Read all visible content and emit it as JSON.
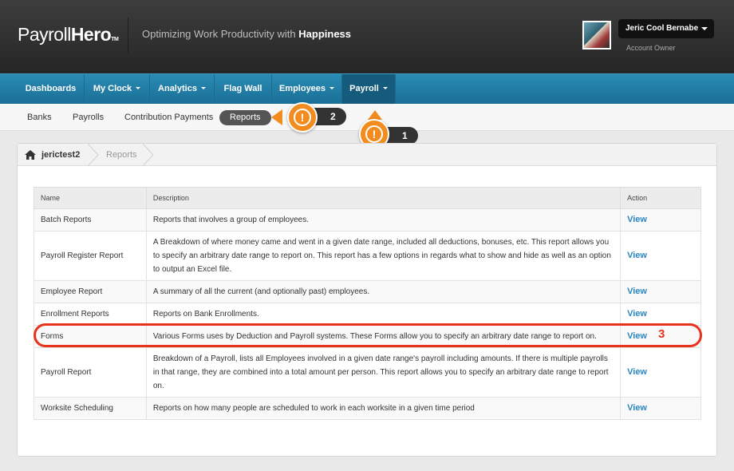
{
  "header": {
    "logo_light": "Payroll",
    "logo_bold": "Hero",
    "logo_tm": "TM",
    "tagline_prefix": "Optimizing Work Productivity with ",
    "tagline_bold": "Happiness",
    "user_name": "Jeric Cool Bernabe",
    "user_role": "Account Owner"
  },
  "nav": {
    "items": [
      {
        "label": "Dashboards"
      },
      {
        "label": "My Clock"
      },
      {
        "label": "Analytics"
      },
      {
        "label": "Flag Wall"
      },
      {
        "label": "Employees"
      },
      {
        "label": "Payroll"
      }
    ]
  },
  "subnav": {
    "items": [
      {
        "label": "Banks"
      },
      {
        "label": "Payrolls"
      },
      {
        "label": "Contribution Payments"
      },
      {
        "label": "Reports"
      }
    ]
  },
  "callouts": [
    {
      "number": "1",
      "symbol": "!"
    },
    {
      "number": "2",
      "symbol": "!"
    }
  ],
  "breadcrumb": {
    "home": "jerictest2",
    "current": "Reports"
  },
  "table": {
    "headers": [
      "Name",
      "Description",
      "Action"
    ],
    "rows": [
      {
        "name": "Batch Reports",
        "description": "Reports that involves a group of employees.",
        "action": "View"
      },
      {
        "name": "Payroll Register Report",
        "description": "A Breakdown of where money came and went in a given date range, included all deductions, bonuses, etc. This report allows you to specify an arbitrary date range to report on. This report has a few options in regards what to show and hide as well as an option to output an Excel file.",
        "action": "View"
      },
      {
        "name": "Employee Report",
        "description": "A summary of all the current (and optionally past) employees.",
        "action": "View"
      },
      {
        "name": "Enrollment Reports",
        "description": "Reports on Bank Enrollments.",
        "action": "View"
      },
      {
        "name": "Forms",
        "description": "Various Forms uses by Deduction and Payroll systems. These Forms allow you to specify an arbitrary date range to report on.",
        "action": "View"
      },
      {
        "name": "Payroll Report",
        "description": "Breakdown of a Payroll, lists all Employees involved in a given date range's payroll including amounts. If there is multiple payrolls in that range, they are combined into a total amount per person. This report allows you to specify an arbitrary date range to report on.",
        "action": "View"
      },
      {
        "name": "Worksite Scheduling",
        "description": "Reports on how many people are scheduled to work in each worksite in a given time period",
        "action": "View"
      }
    ]
  },
  "annotation": {
    "marker": "3"
  },
  "colors": {
    "nav_blue": "#1f7ea8",
    "callout_orange": "#f28c1e",
    "highlight_red": "#e8321c",
    "link_blue": "#2a86c1"
  }
}
